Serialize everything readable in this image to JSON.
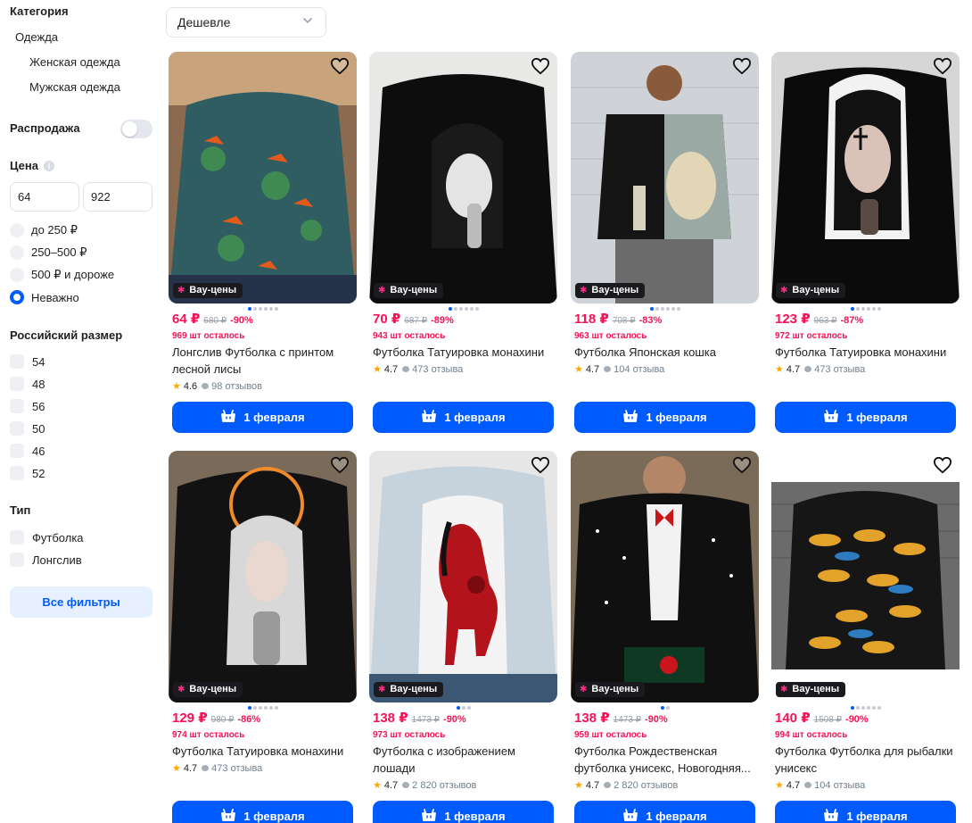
{
  "filters": {
    "category_title": "Категория",
    "category_l1": "Одежда",
    "category_l2": [
      "Женская одежда",
      "Мужская одежда"
    ],
    "sale_label": "Распродажа",
    "price_title": "Цена",
    "price_info_icon": "info-icon",
    "price_min": "64",
    "price_max": "922",
    "price_options": [
      "до 250 ₽",
      "250–500 ₽",
      "500 ₽ и дороже",
      "Неважно"
    ],
    "price_selected": "Неважно",
    "size_title": "Российский размер",
    "sizes": [
      "54",
      "48",
      "56",
      "50",
      "46",
      "52"
    ],
    "type_title": "Тип",
    "types": [
      "Футболка",
      "Лонгслив"
    ],
    "all_filters_label": "Все фильтры"
  },
  "sort": {
    "value": "Дешевле",
    "icon": "chevron-down-icon"
  },
  "colors": {
    "accent": "#005bff",
    "price": "#f91155",
    "badge_bg": "#1b1b1f",
    "star": "#ffa800"
  },
  "products": [
    {
      "badge": "Вау-цены",
      "price": "64 ₽",
      "old_price": "680 ₽",
      "discount": "-90%",
      "left": "969 шт осталось",
      "title": "Лонгслив Футболка с принтом лесной лисы",
      "rating": "4.6",
      "reviews": "98 отзывов",
      "delivery": "1 февраля"
    },
    {
      "badge": "Вау-цены",
      "price": "70 ₽",
      "old_price": "687 ₽",
      "discount": "-89%",
      "left": "943 шт осталось",
      "title": "Футболка Татуировка монахини",
      "rating": "4.7",
      "reviews": "473 отзыва",
      "delivery": "1 февраля"
    },
    {
      "badge": "Вау-цены",
      "price": "118 ₽",
      "old_price": "708 ₽",
      "discount": "-83%",
      "left": "963 шт осталось",
      "title": "Футболка Японская кошка",
      "rating": "4.7",
      "reviews": "104 отзыва",
      "delivery": "1 февраля"
    },
    {
      "badge": "Вау-цены",
      "price": "123 ₽",
      "old_price": "963 ₽",
      "discount": "-87%",
      "left": "972 шт осталось",
      "title": "Футболка Татуировка монахини",
      "rating": "4.7",
      "reviews": "473 отзыва",
      "delivery": "1 февраля"
    },
    {
      "badge": "Вау-цены",
      "price": "129 ₽",
      "old_price": "980 ₽",
      "discount": "-86%",
      "left": "974 шт осталось",
      "title": "Футболка Татуировка монахини",
      "rating": "4.7",
      "reviews": "473 отзыва",
      "delivery": "1 февраля"
    },
    {
      "badge": "Вау-цены",
      "price": "138 ₽",
      "old_price": "1473 ₽",
      "discount": "-90%",
      "left": "973 шт осталось",
      "title": "Футболка с изображением лошади",
      "rating": "4.7",
      "reviews": "2 820 отзывов",
      "delivery": "1 февраля"
    },
    {
      "badge": "Вау-цены",
      "price": "138 ₽",
      "old_price": "1473 ₽",
      "discount": "-90%",
      "left": "959 шт осталось",
      "title": "Футболка Рождественская футболка унисекс, Новогодняя...",
      "rating": "4.7",
      "reviews": "2 820 отзывов",
      "delivery": "1 февраля"
    },
    {
      "badge": "Вау-цены",
      "price": "140 ₽",
      "old_price": "1508 ₽",
      "discount": "-90%",
      "left": "994 шт осталось",
      "title": "Футболка Футболка для рыбалки унисекс",
      "rating": "4.7",
      "reviews": "104 отзыва",
      "delivery": "1 февраля"
    }
  ]
}
